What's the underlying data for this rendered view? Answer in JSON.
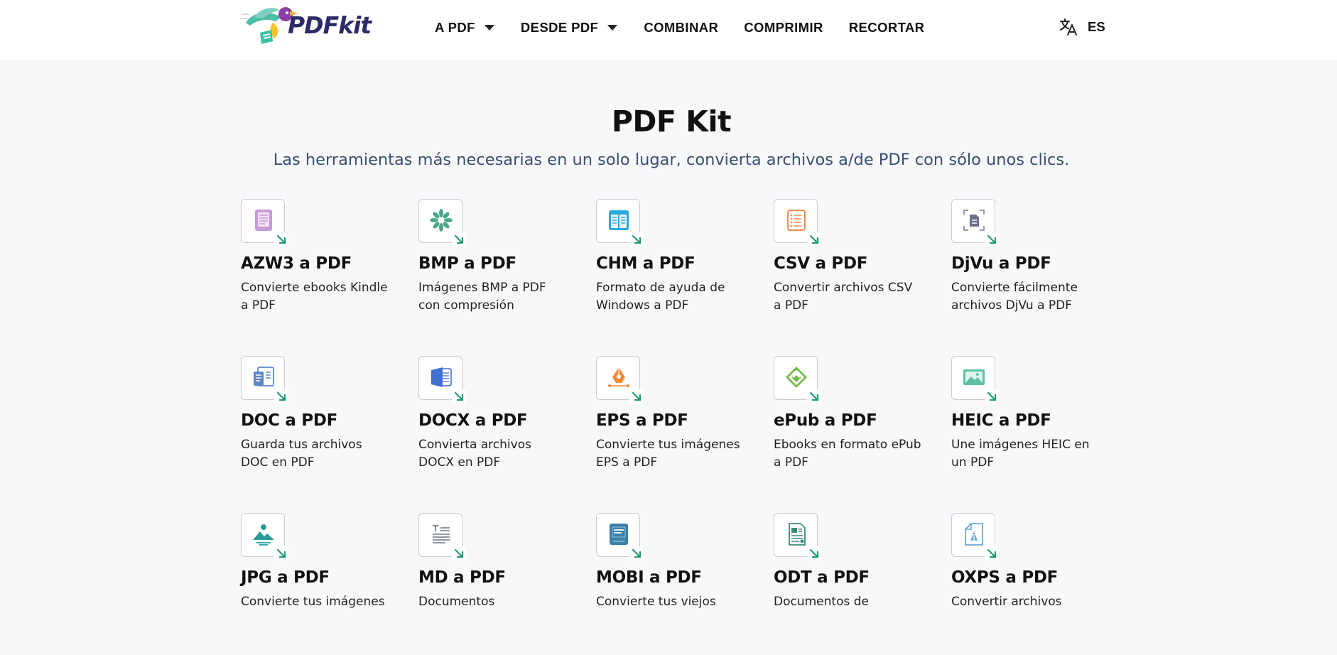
{
  "header": {
    "brand": "PDFkit",
    "nav": [
      {
        "label": "A PDF",
        "dropdown": true
      },
      {
        "label": "DESDE PDF",
        "dropdown": true
      },
      {
        "label": "COMBINAR",
        "dropdown": false
      },
      {
        "label": "COMPRIMIR",
        "dropdown": false
      },
      {
        "label": "RECORTAR",
        "dropdown": false
      }
    ],
    "language": "ES",
    "language_icon": "translate-icon"
  },
  "hero": {
    "title": "PDF Kit",
    "subtitle": "Las herramientas más necesarias en un solo lugar, convierta archivos a/de PDF con sólo unos clics."
  },
  "colors": {
    "accent_arrow": "#1f9a74",
    "brand_text": "#2c2c68",
    "subtitle_text": "#3d4e70",
    "page_bg": "#f7f8fa"
  },
  "tools": [
    {
      "title": "AZW3 a PDF",
      "desc": "Convierte ebooks Kindle a PDF",
      "icon": "azw3-icon",
      "color": "#c79bd6"
    },
    {
      "title": "BMP a PDF",
      "desc": "Imágenes BMP a PDF con compresión",
      "icon": "bmp-icon",
      "color": "#4aa888"
    },
    {
      "title": "CHM a PDF",
      "desc": "Formato de ayuda de Windows a PDF",
      "icon": "chm-icon",
      "color": "#2aa9df"
    },
    {
      "title": "CSV a PDF",
      "desc": "Convertir archivos CSV a PDF",
      "icon": "csv-icon",
      "color": "#f08a4b"
    },
    {
      "title": "DjVu a PDF",
      "desc": "Convierte fácilmente archivos DjVu a PDF",
      "icon": "djvu-icon",
      "color": "#7c7c92"
    },
    {
      "title": "DOC a PDF",
      "desc": "Guarda tus archivos DOC en PDF",
      "icon": "doc-icon",
      "color": "#5b85c7"
    },
    {
      "title": "DOCX a PDF",
      "desc": "Convierta archivos DOCX en PDF",
      "icon": "docx-icon",
      "color": "#3f6fd1"
    },
    {
      "title": "EPS a PDF",
      "desc": "Convierte tus imágenes EPS a PDF",
      "icon": "eps-icon",
      "color": "#f08a3b"
    },
    {
      "title": "ePub a PDF",
      "desc": "Ebooks en formato ePub a PDF",
      "icon": "epub-icon",
      "color": "#74b843"
    },
    {
      "title": "HEIC a PDF",
      "desc": "Une imágenes HEIC en un PDF",
      "icon": "heic-icon",
      "color": "#5fc0a5"
    },
    {
      "title": "JPG a PDF",
      "desc": "Convierte tus imágenes",
      "icon": "jpg-icon",
      "color": "#2a9d9a"
    },
    {
      "title": "MD a PDF",
      "desc": "Documentos",
      "icon": "md-icon",
      "color": "#6b7785"
    },
    {
      "title": "MOBI a PDF",
      "desc": "Convierte tus viejos",
      "icon": "mobi-icon",
      "color": "#3c7fa8"
    },
    {
      "title": "ODT a PDF",
      "desc": "Documentos de",
      "icon": "odt-icon",
      "color": "#3b8a7a"
    },
    {
      "title": "OXPS a PDF",
      "desc": "Convertir archivos",
      "icon": "oxps-icon",
      "color": "#6aa6d8"
    }
  ]
}
